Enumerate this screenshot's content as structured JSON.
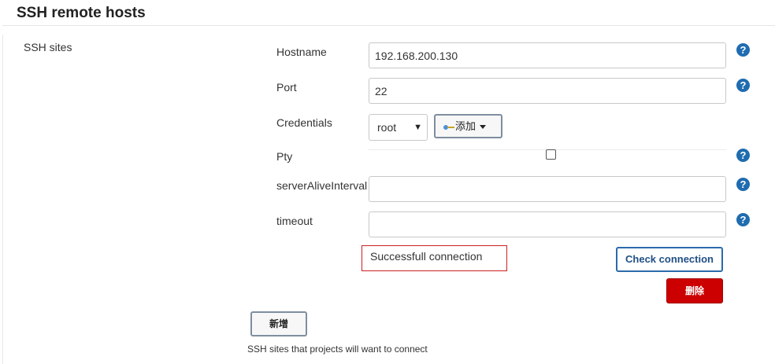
{
  "section": {
    "title": "SSH remote hosts",
    "group_label": "SSH sites",
    "description": "SSH sites that projects will want to connect"
  },
  "fields": {
    "hostname": {
      "label": "Hostname",
      "value": "192.168.200.130"
    },
    "port": {
      "label": "Port",
      "value": "22"
    },
    "credentials": {
      "label": "Credentials",
      "selected": "root",
      "add_label": "添加"
    },
    "pty": {
      "label": "Pty",
      "checked": false
    },
    "server_alive_interval": {
      "label": "serverAliveInterval",
      "value": ""
    },
    "timeout": {
      "label": "timeout",
      "value": ""
    }
  },
  "help_glyph": "?",
  "status": {
    "message": "Successfull connection",
    "border_color": "#cc1f1f"
  },
  "buttons": {
    "check_connection": "Check connection",
    "delete": "删除",
    "add_new": "新增"
  },
  "colors": {
    "help_icon": "#1f6cb0",
    "delete_button": "#cc0000",
    "check_border": "#2b6bab"
  },
  "icons": {
    "help": "question-circle-icon",
    "credential_key": "key-icon",
    "dropdown": "chevron-down-icon"
  }
}
